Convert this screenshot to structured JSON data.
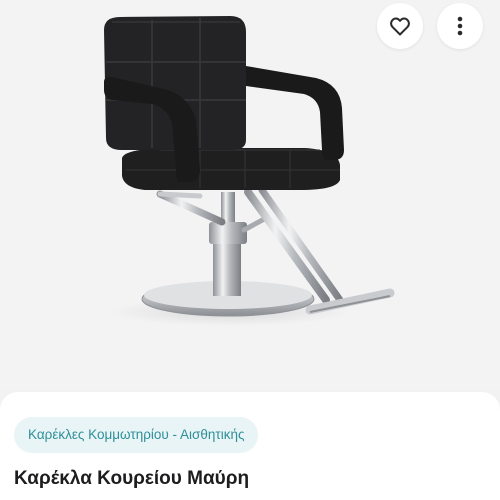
{
  "product": {
    "image_alt": "black barber chair",
    "category": "Καρέκλες Κομμωτηρίου - Αισθητικής",
    "title": "Καρέκλα Κουρείου Μαύρη"
  },
  "actions": {
    "favorite_icon": "heart-outline-icon",
    "more_icon": "vertical-dots-icon"
  },
  "colors": {
    "accent": "#2f8f99",
    "chip_background": "#e8f4f5",
    "title_text": "#1d1d1f"
  }
}
